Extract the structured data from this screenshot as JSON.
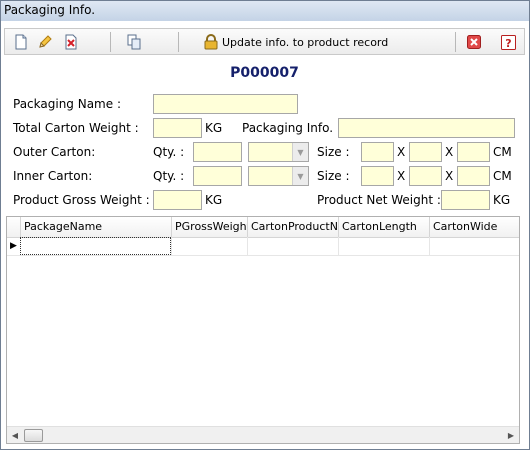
{
  "window": {
    "title": "Packaging Info."
  },
  "toolbar": {
    "new_icon": "new-document-icon",
    "edit_icon": "pencil-icon",
    "delete_icon": "delete-document-icon",
    "copy_icon": "copy-icon",
    "update_label": "Update info. to product record",
    "close_icon": "red-x-icon",
    "help_icon": "help-icon"
  },
  "form": {
    "record_id": "P000007",
    "packaging_name_label": "Packaging Name :",
    "packaging_name_value": "",
    "total_weight_label": "Total Carton Weight :",
    "total_weight_unit": "KG",
    "packaging_info_label": "Packaging Info. :",
    "outer_carton_label": "Outer Carton:",
    "inner_carton_label": "Inner Carton:",
    "qty_label": "Qty. :",
    "size_label": "Size :",
    "x_label": "X",
    "size_unit": "CM",
    "gross_weight_label": "Product Gross Weight :",
    "gross_weight_unit": "KG",
    "net_weight_label": "Product Net Weight :",
    "net_weight_unit": "KG"
  },
  "grid": {
    "columns": [
      "PackageName",
      "PGrossWeight",
      "CartonProductNo",
      "CartonLength",
      "CartonWide"
    ],
    "rows": [
      [
        "",
        "",
        "",
        "",
        ""
      ]
    ]
  },
  "colors": {
    "field_bg": "#ffffd9",
    "id_color": "#15206b",
    "title_bar": "#c4d3e6"
  }
}
